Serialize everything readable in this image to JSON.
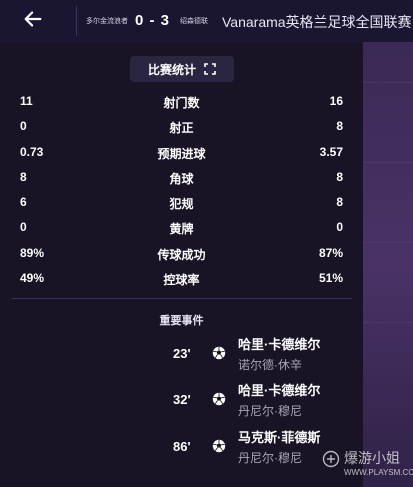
{
  "header": {
    "home_team": "多尔金流浪者",
    "score": "0 - 3",
    "away_team": "绍森德联",
    "competition": "Vanarama英格兰足球全国联赛"
  },
  "stats_panel": {
    "title": "比赛统计",
    "rows": [
      {
        "left": "11",
        "label": "射门数",
        "right": "16"
      },
      {
        "left": "0",
        "label": "射正",
        "right": "8"
      },
      {
        "left": "0.73",
        "label": "预期进球",
        "right": "3.57"
      },
      {
        "left": "8",
        "label": "角球",
        "right": "8"
      },
      {
        "left": "6",
        "label": "犯规",
        "right": "8"
      },
      {
        "left": "0",
        "label": "黄牌",
        "right": "0"
      },
      {
        "left": "89%",
        "label": "传球成功",
        "right": "87%"
      },
      {
        "left": "49%",
        "label": "控球率",
        "right": "51%"
      }
    ]
  },
  "events": {
    "title": "重要事件",
    "items": [
      {
        "minute": "23'",
        "scorer": "哈里·卡德维尔",
        "assist": "诺尔德·休辛",
        "icon": "football-icon"
      },
      {
        "minute": "32'",
        "scorer": "哈里·卡德维尔",
        "assist": "丹尼尔·穆尼",
        "icon": "football-icon"
      },
      {
        "minute": "86'",
        "scorer": "马克斯·菲德斯",
        "assist": "丹尼尔·穆尼",
        "icon": "football-icon"
      }
    ]
  },
  "watermark": {
    "text": "爆游小姐",
    "url": "WWW.PLAYSM.CC"
  },
  "colors": {
    "background": "#15102a",
    "panel": "#181325",
    "button": "#2a2540",
    "accent_strip": "#4a3266"
  }
}
